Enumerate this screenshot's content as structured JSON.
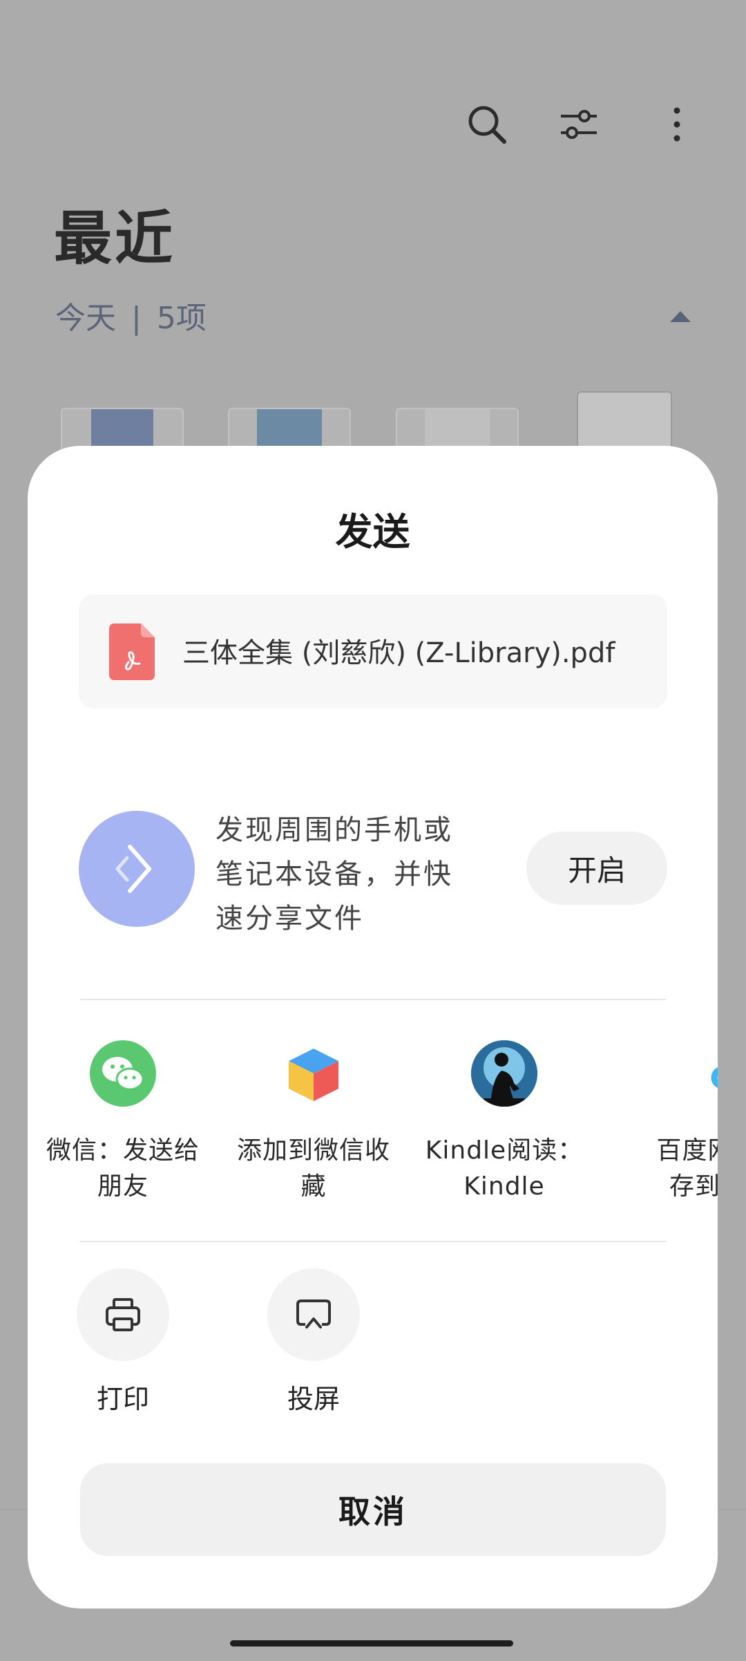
{
  "background": {
    "header": {
      "title": "最近",
      "day_label": "今天",
      "separator": "|",
      "count_label": "5项",
      "icons": [
        "search-icon",
        "filter-icon",
        "more-icon"
      ]
    }
  },
  "share_sheet": {
    "title": "发送",
    "file": {
      "name": "三体全集 (刘慈欣) (Z-Library).pdf",
      "icon": "pdf-file-icon"
    },
    "nearby": {
      "description": "发现周围的手机或笔记本设备，并快速分享文件",
      "line1": "发现周围的手机或",
      "line2": "笔记本设备，并快",
      "line3": "速分享文件",
      "button_label": "开启"
    },
    "apps": [
      {
        "line1": "微信：发送给",
        "line2": "朋友",
        "icon": "wechat-icon"
      },
      {
        "line1": "添加到微信收",
        "line2": "藏",
        "icon": "wechat-favorites-icon"
      },
      {
        "line1": "Kindle阅读：",
        "line2": "Kindle",
        "icon": "kindle-icon"
      },
      {
        "line1": "百度网",
        "line2": "存到",
        "icon": "baidu-netdisk-icon"
      }
    ],
    "actions": [
      {
        "label": "打印",
        "icon": "printer-icon"
      },
      {
        "label": "投屏",
        "icon": "screencast-icon"
      }
    ],
    "cancel_label": "取消"
  },
  "colors": {
    "overlay": "#ababab",
    "sheet": "#ffffff",
    "nearby_accent": "#a7b4f4",
    "pdf_icon": "#f07070",
    "wechat_green": "#5ac870"
  }
}
